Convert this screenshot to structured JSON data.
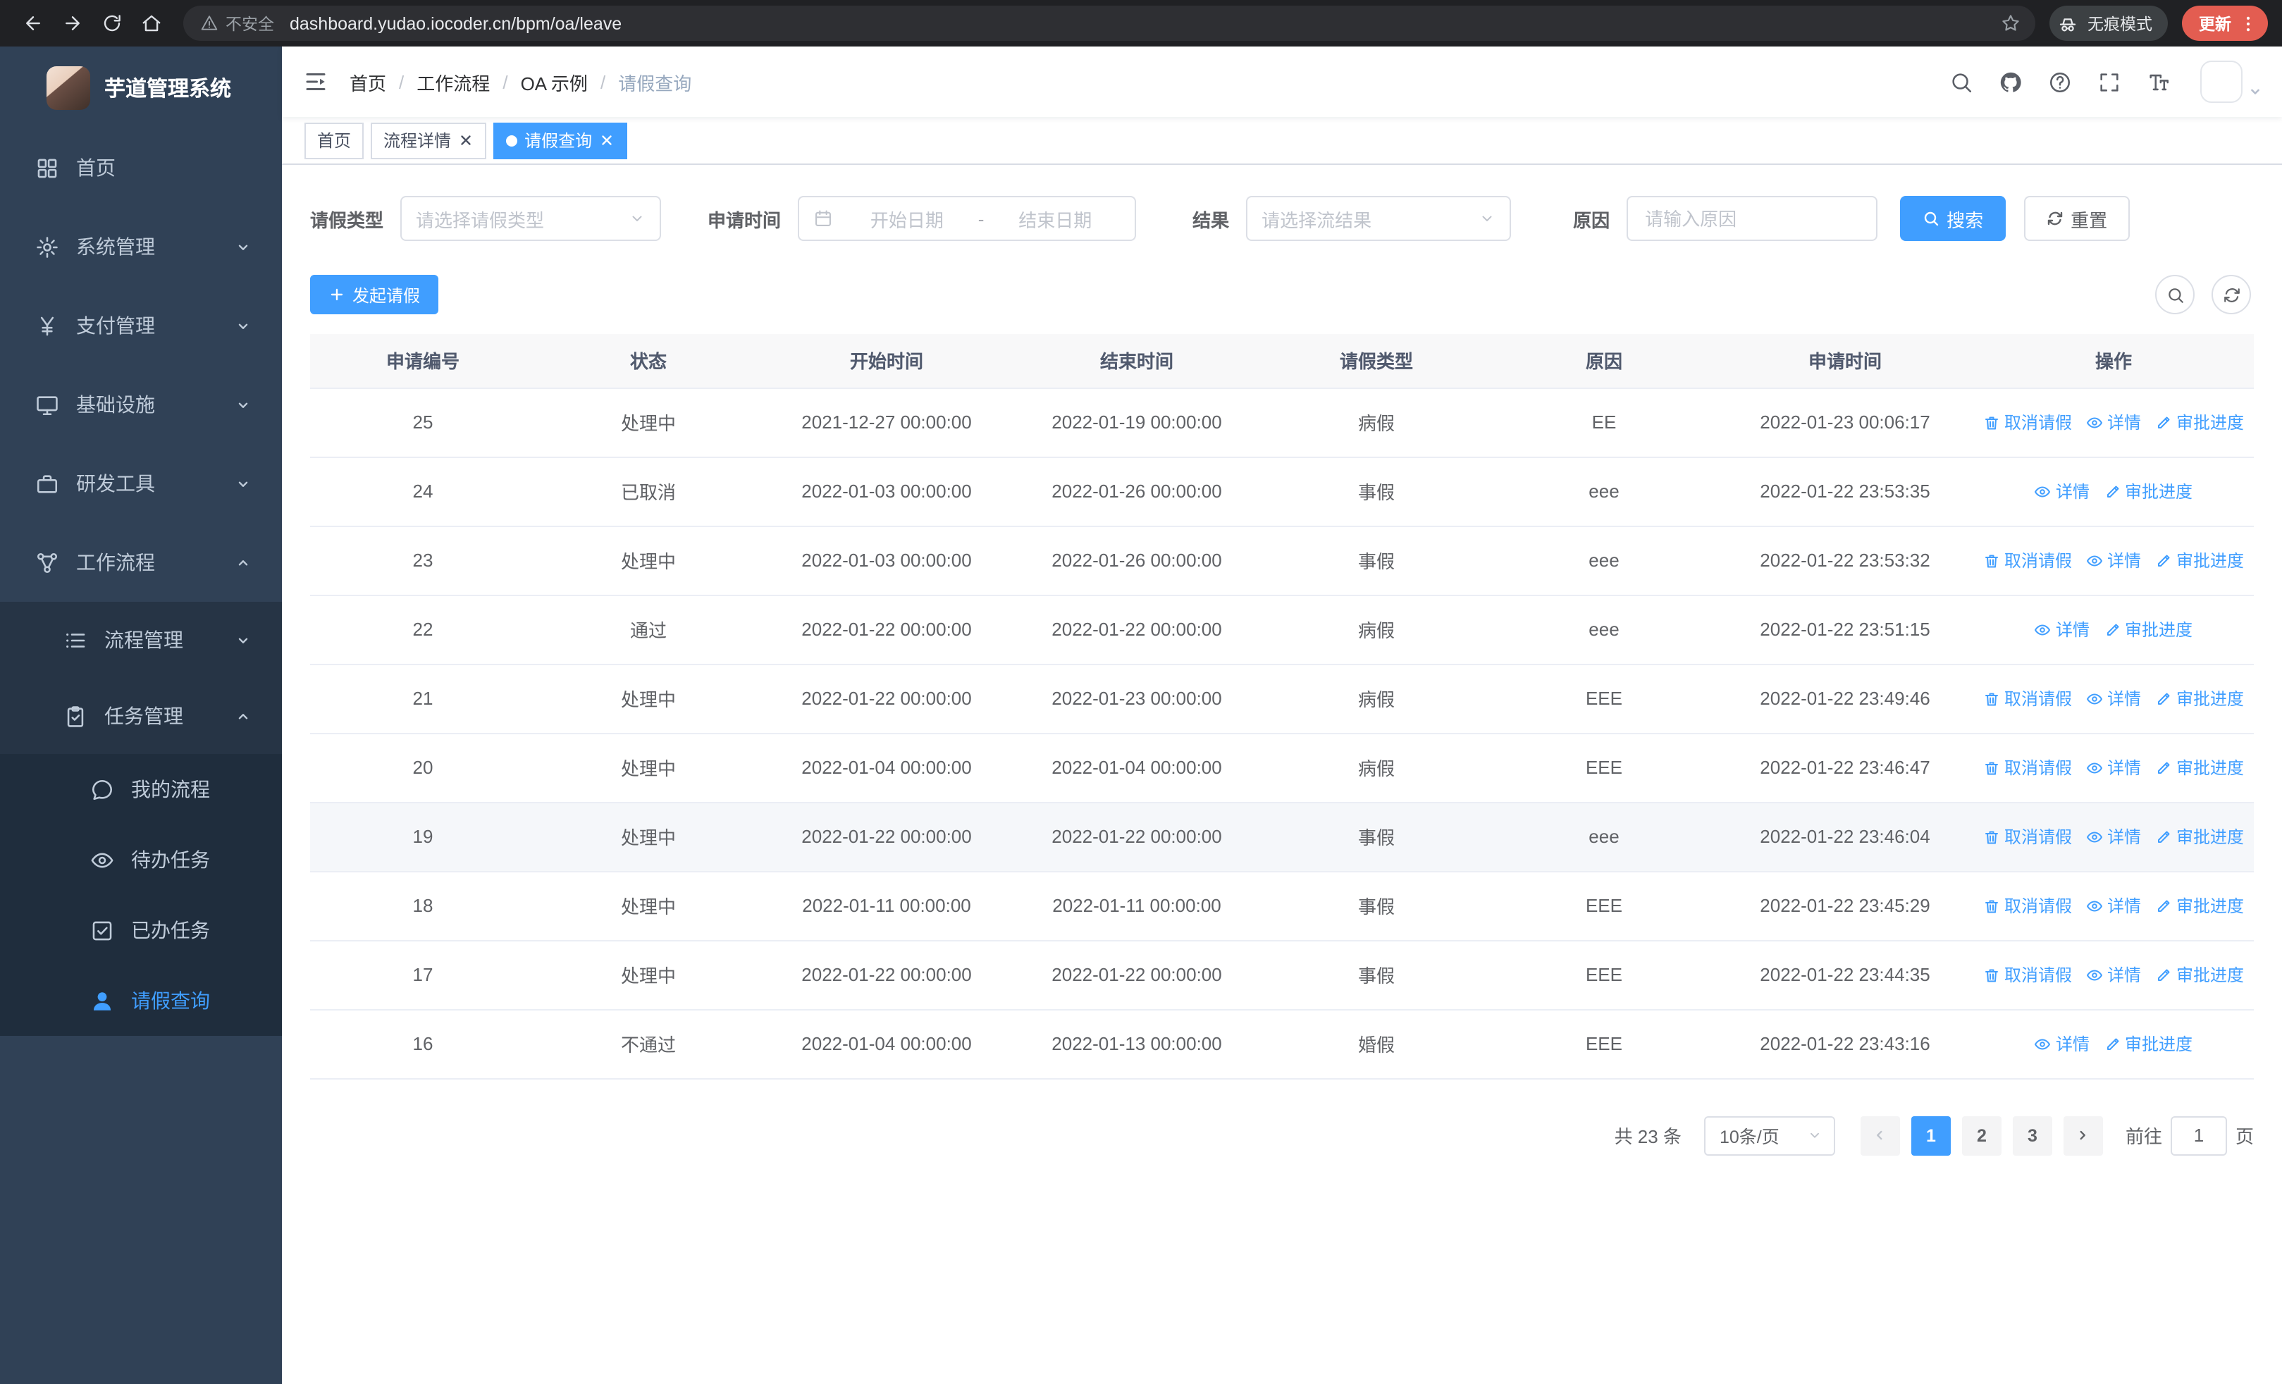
{
  "colors": {
    "primary": "#409EFF",
    "sidebar_bg": "#304156",
    "tag_active": "#409EFF"
  },
  "browser": {
    "security_label": "不安全",
    "url": "dashboard.yudao.iocoder.cn/bpm/oa/leave",
    "incognito_label": "无痕模式",
    "update_label": "更新"
  },
  "sidebar": {
    "app_title": "芋道管理系统",
    "items": {
      "home": "首页",
      "system": "系统管理",
      "payment": "支付管理",
      "infra": "基础设施",
      "dev_tools": "研发工具",
      "workflow": "工作流程",
      "process_mgmt": "流程管理",
      "task_mgmt": "任务管理",
      "my_process": "我的流程",
      "todo_tasks": "待办任务",
      "done_tasks": "已办任务",
      "leave_query": "请假查询"
    }
  },
  "navbar": {
    "breadcrumb": [
      "首页",
      "工作流程",
      "OA 示例",
      "请假查询"
    ]
  },
  "tabs": [
    {
      "label": "首页"
    },
    {
      "label": "流程详情"
    },
    {
      "label": "请假查询"
    }
  ],
  "filters": {
    "leave_type_label": "请假类型",
    "leave_type_placeholder": "请选择请假类型",
    "apply_time_label": "申请时间",
    "date_start_placeholder": "开始日期",
    "date_separator": "-",
    "date_end_placeholder": "结束日期",
    "result_label": "结果",
    "result_placeholder": "请选择流结果",
    "reason_label": "原因",
    "reason_placeholder": "请输入原因",
    "search_button": "搜索",
    "reset_button": "重置"
  },
  "toolbar": {
    "create_button": "发起请假"
  },
  "table": {
    "headers": [
      "申请编号",
      "状态",
      "开始时间",
      "结束时间",
      "请假类型",
      "原因",
      "申请时间",
      "操作"
    ],
    "action_labels": {
      "cancel": "取消请假",
      "detail": "详情",
      "progress": "审批进度"
    },
    "rows": [
      {
        "id": "25",
        "status": "处理中",
        "start": "2021-12-27 00:00:00",
        "end": "2022-01-19 00:00:00",
        "type": "病假",
        "reason": "EE",
        "apply_time": "2022-01-23 00:06:17",
        "actions": [
          "cancel",
          "detail",
          "progress"
        ],
        "highlighted": false
      },
      {
        "id": "24",
        "status": "已取消",
        "start": "2022-01-03 00:00:00",
        "end": "2022-01-26 00:00:00",
        "type": "事假",
        "reason": "eee",
        "apply_time": "2022-01-22 23:53:35",
        "actions": [
          "detail",
          "progress"
        ],
        "highlighted": false
      },
      {
        "id": "23",
        "status": "处理中",
        "start": "2022-01-03 00:00:00",
        "end": "2022-01-26 00:00:00",
        "type": "事假",
        "reason": "eee",
        "apply_time": "2022-01-22 23:53:32",
        "actions": [
          "cancel",
          "detail",
          "progress"
        ],
        "highlighted": false
      },
      {
        "id": "22",
        "status": "通过",
        "start": "2022-01-22 00:00:00",
        "end": "2022-01-22 00:00:00",
        "type": "病假",
        "reason": "eee",
        "apply_time": "2022-01-22 23:51:15",
        "actions": [
          "detail",
          "progress"
        ],
        "highlighted": false
      },
      {
        "id": "21",
        "status": "处理中",
        "start": "2022-01-22 00:00:00",
        "end": "2022-01-23 00:00:00",
        "type": "病假",
        "reason": "EEE",
        "apply_time": "2022-01-22 23:49:46",
        "actions": [
          "cancel",
          "detail",
          "progress"
        ],
        "highlighted": false
      },
      {
        "id": "20",
        "status": "处理中",
        "start": "2022-01-04 00:00:00",
        "end": "2022-01-04 00:00:00",
        "type": "病假",
        "reason": "EEE",
        "apply_time": "2022-01-22 23:46:47",
        "actions": [
          "cancel",
          "detail",
          "progress"
        ],
        "highlighted": false
      },
      {
        "id": "19",
        "status": "处理中",
        "start": "2022-01-22 00:00:00",
        "end": "2022-01-22 00:00:00",
        "type": "事假",
        "reason": "eee",
        "apply_time": "2022-01-22 23:46:04",
        "actions": [
          "cancel",
          "detail",
          "progress"
        ],
        "highlighted": true
      },
      {
        "id": "18",
        "status": "处理中",
        "start": "2022-01-11 00:00:00",
        "end": "2022-01-11 00:00:00",
        "type": "事假",
        "reason": "EEE",
        "apply_time": "2022-01-22 23:45:29",
        "actions": [
          "cancel",
          "detail",
          "progress"
        ],
        "highlighted": false
      },
      {
        "id": "17",
        "status": "处理中",
        "start": "2022-01-22 00:00:00",
        "end": "2022-01-22 00:00:00",
        "type": "事假",
        "reason": "EEE",
        "apply_time": "2022-01-22 23:44:35",
        "actions": [
          "cancel",
          "detail",
          "progress"
        ],
        "highlighted": false
      },
      {
        "id": "16",
        "status": "不通过",
        "start": "2022-01-04 00:00:00",
        "end": "2022-01-13 00:00:00",
        "type": "婚假",
        "reason": "EEE",
        "apply_time": "2022-01-22 23:43:16",
        "actions": [
          "detail",
          "progress"
        ],
        "highlighted": false
      }
    ]
  },
  "pagination": {
    "total_label": "共 23 条",
    "page_size": "10条/页",
    "pages": [
      "1",
      "2",
      "3"
    ],
    "active_page": "1",
    "goto_prefix": "前往",
    "goto_value": "1",
    "goto_suffix": "页"
  }
}
